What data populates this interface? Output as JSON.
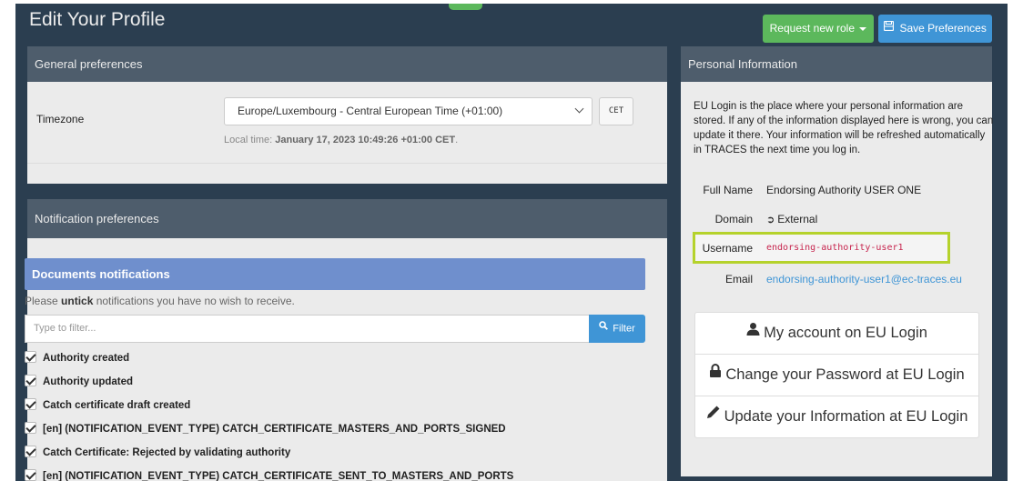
{
  "page": {
    "title": "Edit Your Profile"
  },
  "toolbar": {
    "request_role_label": "Request new role",
    "save_label": "Save Preferences"
  },
  "general": {
    "heading": "General preferences",
    "timezone_label": "Timezone",
    "timezone_value": "Europe/Luxembourg - Central European Time (+01:00)",
    "tz_code": "CET",
    "local_time_prefix": "Local time: ",
    "local_time_value": "January 17, 2023 10:49:26 +01:00 CET",
    "local_time_suffix": "."
  },
  "notifications": {
    "heading": "Notification preferences",
    "section_title": "Documents notifications",
    "hint_prefix": "Please ",
    "hint_bold": "untick",
    "hint_suffix": " notifications you have no wish to receive.",
    "filter_placeholder": "Type to filter...",
    "filter_button": "Filter",
    "items": [
      {
        "label": "Authority created",
        "checked": true
      },
      {
        "label": "Authority updated",
        "checked": true
      },
      {
        "label": "Catch certificate draft created",
        "checked": true
      },
      {
        "label": "[en] (NOTIFICATION_EVENT_TYPE) CATCH_CERTIFICATE_MASTERS_AND_PORTS_SIGNED",
        "checked": true
      },
      {
        "label": "Catch Certificate: Rejected by validating authority",
        "checked": true
      },
      {
        "label": "[en] (NOTIFICATION_EVENT_TYPE) CATCH_CERTIFICATE_SENT_TO_MASTERS_AND_PORTS",
        "checked": true
      }
    ]
  },
  "personal": {
    "heading": "Personal Information",
    "intro": "EU Login is the place where your personal information are stored. If any of the information displayed here is wrong, you can update it there. Your information will be refreshed automatically in TRACES the next time you log in.",
    "fields": {
      "full_name_label": "Full Name",
      "full_name_value": "Endorsing Authority USER ONE",
      "domain_label": "Domain",
      "domain_value": "External",
      "username_label": "Username",
      "username_value": "endorsing-authority-user1",
      "email_label": "Email",
      "email_value": "endorsing-authority-user1@ec-traces.eu"
    },
    "links": [
      {
        "label": "My account on EU Login",
        "icon": "user-icon"
      },
      {
        "label": "Change your Password at EU Login",
        "icon": "lock-icon"
      },
      {
        "label": "Update your Information at EU Login",
        "icon": "pencil-icon"
      }
    ]
  },
  "colors": {
    "background": "#2b3e50",
    "panel_heading": "#4e5d6c",
    "success": "#5cb85c",
    "primary": "#3f95d6",
    "highlight": "#b5d22c"
  }
}
